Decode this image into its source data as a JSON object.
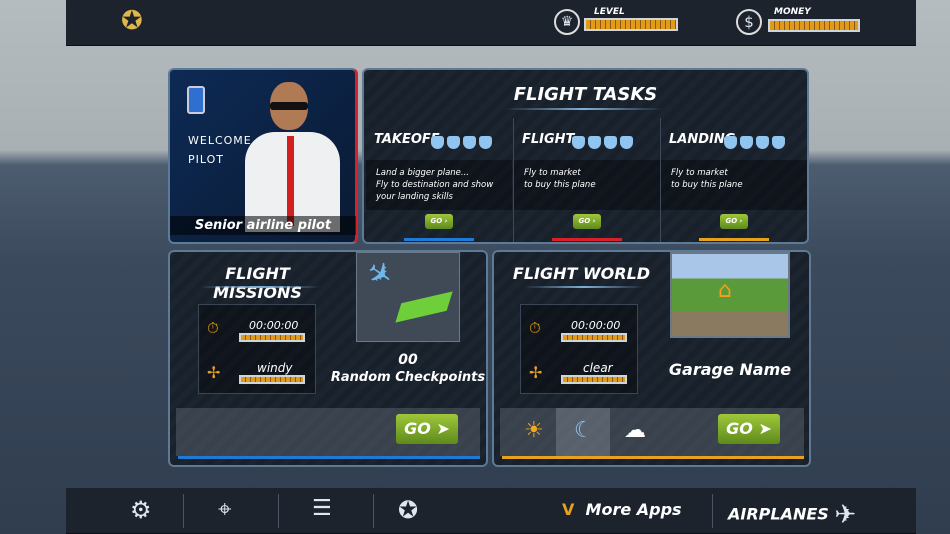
{
  "top_bar": {
    "logo": "pilot-wings-logo",
    "level_label": "LEVEL",
    "level_fill": 1.0,
    "money_label": "MONEY",
    "money_fill": 1.0
  },
  "pilot": {
    "welcome": "WELCOME",
    "pilot": "PILOT",
    "rank": "Senior airline pilot"
  },
  "tasks": {
    "title": "FLIGHT TASKS",
    "columns": [
      {
        "name": "TAKEOFF",
        "desc": [
          "Land a bigger plane...",
          "Fly to destination and show",
          "your landing skills"
        ],
        "go": "GO",
        "color": "#1e7ad6"
      },
      {
        "name": "FLIGHT",
        "desc": [
          "Fly to market",
          "to buy this plane"
        ],
        "go": "GO",
        "color": "#d8202a"
      },
      {
        "name": "LANDING",
        "desc": [
          "Fly to market",
          "to buy this plane"
        ],
        "go": "GO",
        "color": "#e6a21c"
      }
    ]
  },
  "missions": {
    "title": "FLIGHT MISSIONS",
    "time": "00:00:00",
    "weather": "windy",
    "count": "00",
    "checkpoints": "Random Checkpoints",
    "go": "GO"
  },
  "world": {
    "title": "FLIGHT WORLD",
    "time": "00:00:00",
    "weather": "clear",
    "garage": "Garage Name",
    "go": "GO"
  },
  "bottom_bar": {
    "more_apps": "More Apps",
    "airplanes": "AIRPLANES"
  }
}
